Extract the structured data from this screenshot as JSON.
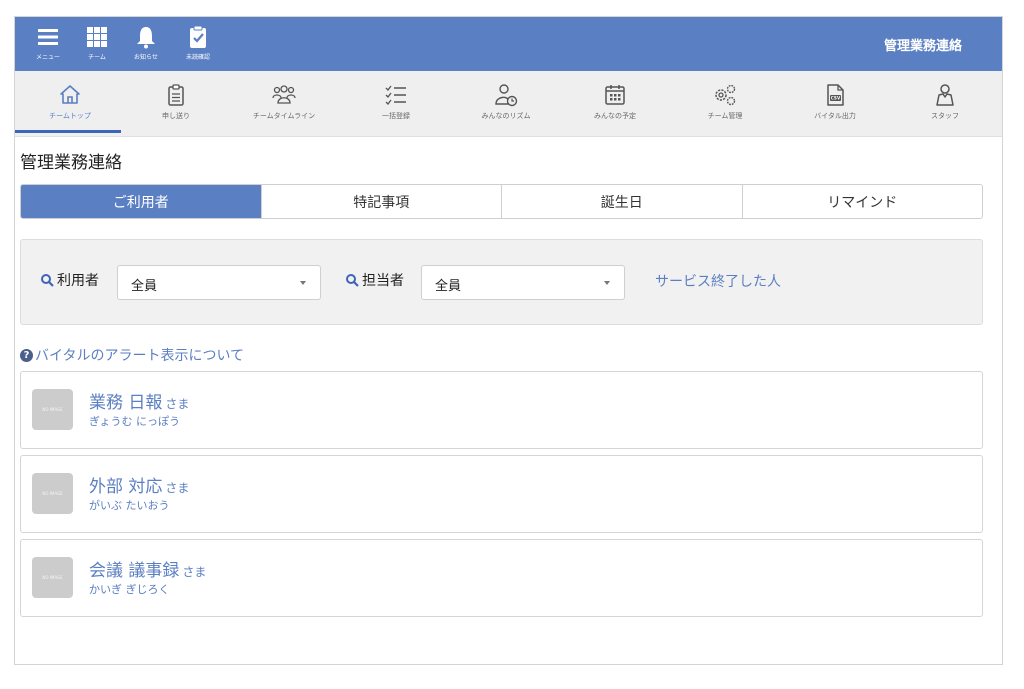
{
  "topbar": {
    "buttons": [
      {
        "label": "メニュー",
        "icon": "menu-icon"
      },
      {
        "label": "チーム",
        "icon": "grid-icon"
      },
      {
        "label": "お知らせ",
        "icon": "bell-icon"
      },
      {
        "label": "未読確認",
        "icon": "clipboard-check-icon"
      }
    ],
    "title": "管理業務連絡"
  },
  "nav": {
    "items": [
      {
        "label": "チームトップ",
        "icon": "home-icon"
      },
      {
        "label": "申し送り",
        "icon": "clipboard-list-icon"
      },
      {
        "label": "チームタイムライン",
        "icon": "people-icon"
      },
      {
        "label": "一括登録",
        "icon": "checklist-icon"
      },
      {
        "label": "みんなのリズム",
        "icon": "person-clock-icon"
      },
      {
        "label": "みんなの予定",
        "icon": "calendar-icon"
      },
      {
        "label": "チーム管理",
        "icon": "gears-icon"
      },
      {
        "label": "バイタル出力",
        "icon": "csv-file-icon"
      },
      {
        "label": "スタッフ",
        "icon": "staff-icon"
      }
    ]
  },
  "page": {
    "title": "管理業務連絡"
  },
  "tabs": [
    "ご利用者",
    "特記事項",
    "誕生日",
    "リマインド"
  ],
  "filter": {
    "user_label": "利用者",
    "user_value": "全員",
    "staff_label": "担当者",
    "staff_value": "全員",
    "ended_link": "サービス終了した人"
  },
  "alert_info": {
    "text": "バイタルのアラート表示について",
    "icon": "question-circle-icon"
  },
  "users": [
    {
      "name": "業務 日報",
      "suffix": "さま",
      "kana": "ぎょうむ にっぽう",
      "avatar": "NO IMAGE"
    },
    {
      "name": "外部 対応",
      "suffix": "さま",
      "kana": "がいぶ たいおう",
      "avatar": "NO IMAGE"
    },
    {
      "name": "会議 議事録",
      "suffix": "さま",
      "kana": "かいぎ ぎじろく",
      "avatar": "NO IMAGE"
    }
  ],
  "colors": {
    "brand": "#5b7fc3",
    "nav_bg": "#efefef",
    "active_underline": "#3d64b6"
  }
}
